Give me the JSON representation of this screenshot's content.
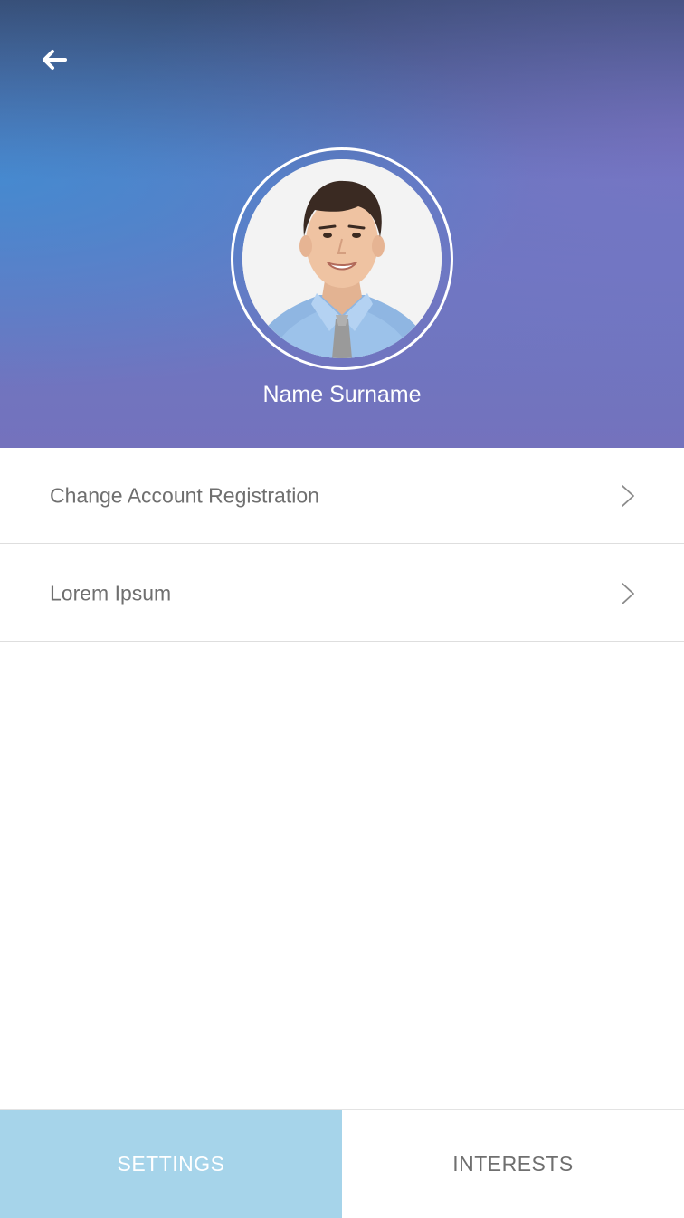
{
  "header": {
    "back_icon": "arrow-left-icon",
    "user_name": "Name Surname",
    "avatar_icon": "profile-photo"
  },
  "menu": {
    "items": [
      {
        "label": "Change Account Registration",
        "icon": "chevron-right-icon"
      },
      {
        "label": "Lorem Ipsum",
        "icon": "chevron-right-icon"
      }
    ]
  },
  "tabs": [
    {
      "label": "SETTINGS",
      "active": true
    },
    {
      "label": "INTERESTS",
      "active": false
    }
  ],
  "colors": {
    "active_tab": "#a6d4ea",
    "header_gradient_start": "#428cd2",
    "header_gradient_end": "#7472bd",
    "text_gray": "#6f6f6f"
  }
}
